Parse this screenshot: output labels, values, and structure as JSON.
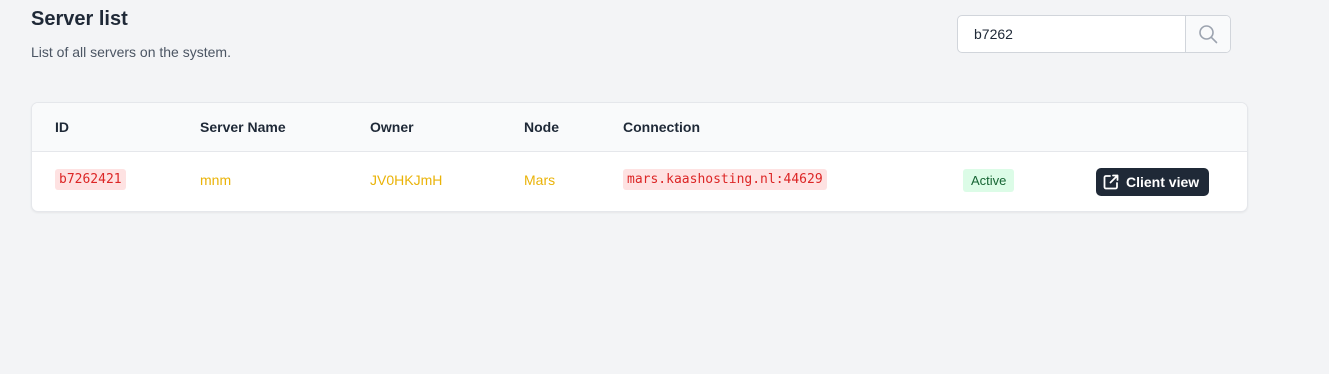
{
  "header": {
    "title": "Server list",
    "subtitle": "List of all servers on the system."
  },
  "search": {
    "value": "b7262",
    "icon": "search-icon"
  },
  "table": {
    "columns": [
      "ID",
      "Server Name",
      "Owner",
      "Node",
      "Connection"
    ],
    "rows": [
      {
        "id": "b7262421",
        "server_name": "mnm",
        "owner": "JV0HKJmH",
        "node": "Mars",
        "connection": "mars.kaashosting.nl:44629",
        "status": "Active",
        "action_label": "Client view",
        "action_icon": "external-link-icon"
      }
    ]
  },
  "colors": {
    "background": "#f3f4f6",
    "code_text": "#dc2626",
    "code_bg": "#fee2e2",
    "link_yellow": "#eab308",
    "status_bg": "#dcfce7",
    "status_text": "#166534",
    "button_bg": "#1f2937"
  }
}
